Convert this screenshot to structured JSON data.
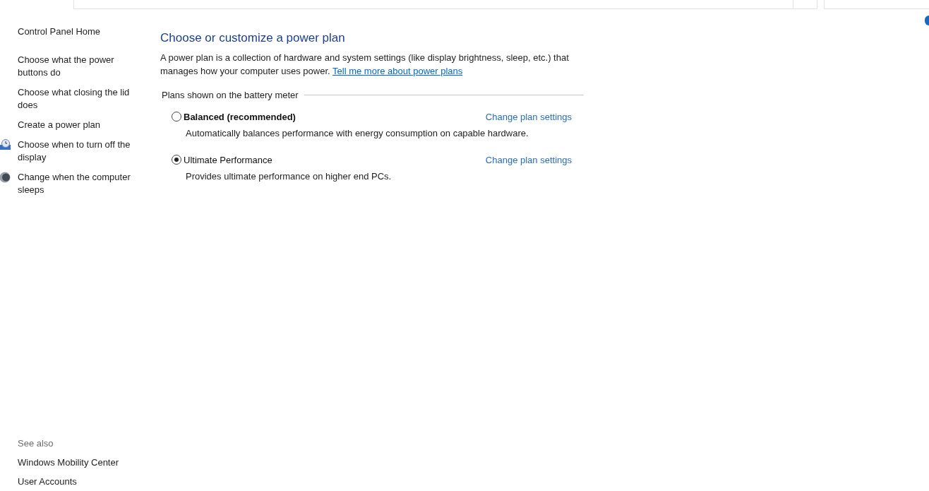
{
  "sidebar": {
    "home": "Control Panel Home",
    "items": [
      {
        "label": "Choose what the power buttons do",
        "kind": "plain"
      },
      {
        "label": "Choose what closing the lid does",
        "kind": "plain"
      },
      {
        "label": "Create a power plan",
        "kind": "plain"
      },
      {
        "label": "Choose when to turn off the display",
        "kind": "display"
      },
      {
        "label": "Change when the computer sleeps",
        "kind": "sleep"
      }
    ],
    "see_also": {
      "title": "See also",
      "links": [
        "Windows Mobility Center",
        "User Accounts"
      ]
    }
  },
  "main": {
    "title": "Choose or customize a power plan",
    "description": "A power plan is a collection of hardware and system settings (like display brightness, sleep, etc.) that manages how your computer uses power.",
    "more_link": "Tell me more about power plans",
    "group_label": "Plans shown on the battery meter",
    "plans": [
      {
        "name": "Balanced (recommended)",
        "bold": true,
        "selected": false,
        "description": "Automatically balances performance with energy consumption on capable hardware.",
        "link": "Change plan settings"
      },
      {
        "name": "Ultimate Performance",
        "bold": false,
        "selected": true,
        "description": "Provides ultimate performance on higher end PCs.",
        "link": "Change plan settings"
      }
    ]
  }
}
